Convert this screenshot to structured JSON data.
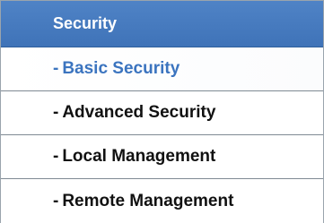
{
  "menu": {
    "header_label": "Security",
    "items": [
      {
        "prefix": "-",
        "label": "Basic Security",
        "active": true
      },
      {
        "prefix": "-",
        "label": "Advanced Security",
        "active": false
      },
      {
        "prefix": "-",
        "label": "Local Management",
        "active": false
      },
      {
        "prefix": "-",
        "label": "Remote Management",
        "active": false
      }
    ]
  },
  "colors": {
    "header_background": "#4179bd",
    "header_text": "#ffffff",
    "active_item_text": "#3b74bf",
    "item_text": "#111111",
    "divider": "#7f8a93"
  }
}
